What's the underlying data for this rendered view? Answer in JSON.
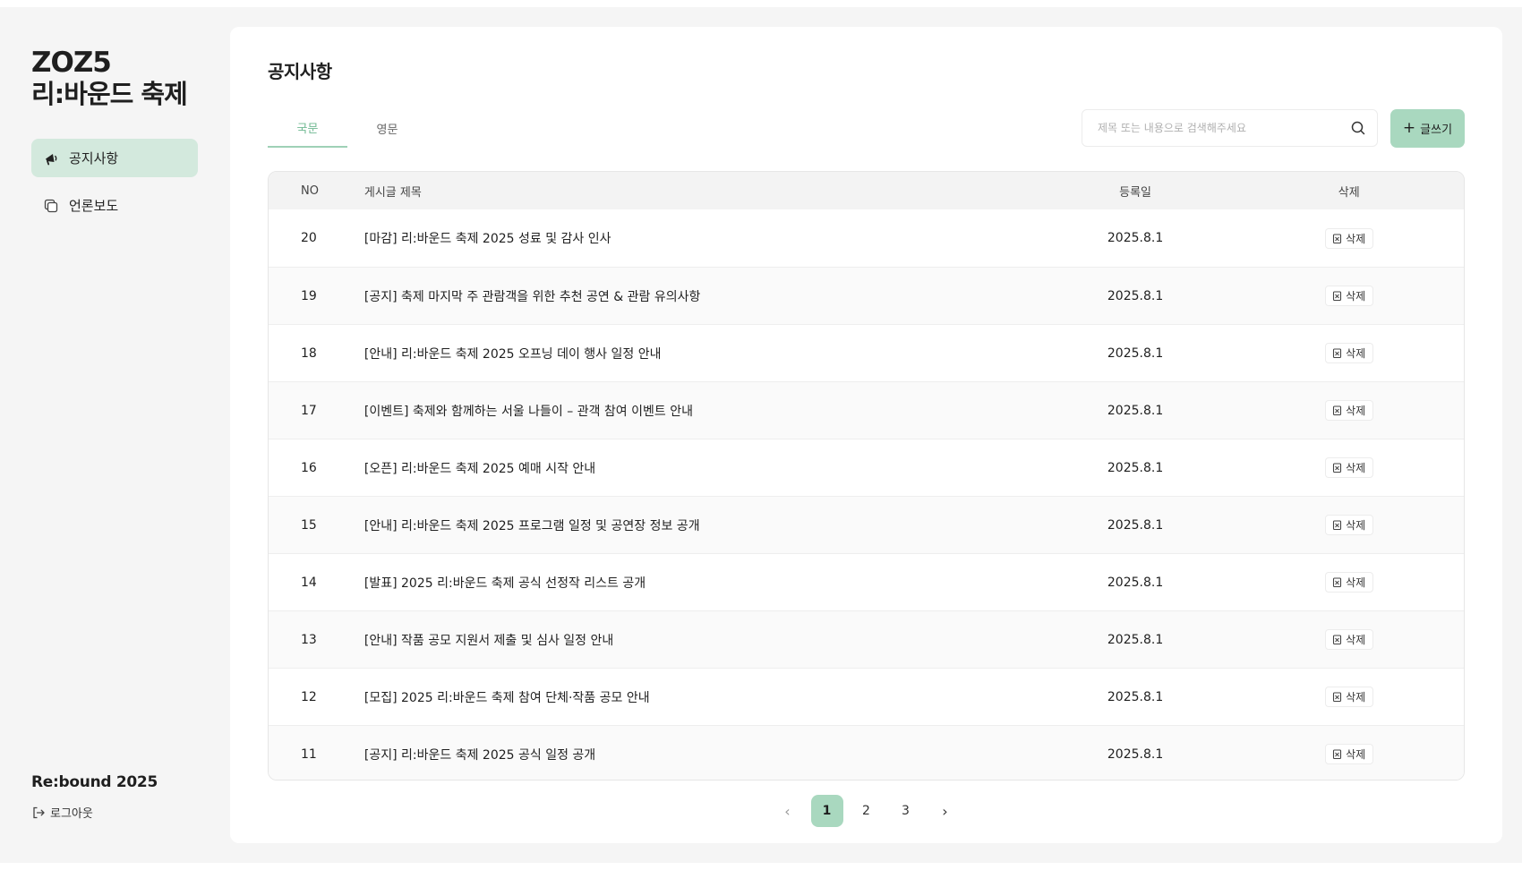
{
  "sidebar": {
    "logo_year": "ZOZ5",
    "logo_title": "리:바운드 축제",
    "items": [
      {
        "label": "공지사항",
        "icon": "megaphone-icon",
        "active": true
      },
      {
        "label": "언론보도",
        "icon": "documents-icon",
        "active": false
      }
    ],
    "brand": "Re:bound 2025",
    "logout_label": "로그아웃"
  },
  "main": {
    "title": "공지사항",
    "tabs": [
      {
        "label": "국문",
        "active": true
      },
      {
        "label": "영문",
        "active": false
      }
    ],
    "search": {
      "placeholder": "제목 또는 내용으로 검색해주세요",
      "value": ""
    },
    "write_label": "글쓰기"
  },
  "table": {
    "headers": {
      "no": "NO",
      "title": "게시글 제목",
      "date": "등록일",
      "delete": "삭제"
    },
    "delete_label": "삭제",
    "rows": [
      {
        "no": "20",
        "title": "[마감] 리:바운드 축제 2025 성료 및 감사 인사",
        "date": "2025.8.1"
      },
      {
        "no": "19",
        "title": "[공지] 축제 마지막 주 관람객을 위한 추천 공연 & 관람 유의사항",
        "date": "2025.8.1"
      },
      {
        "no": "18",
        "title": "[안내] 리:바운드 축제 2025 오프닝 데이 행사 일정 안내",
        "date": "2025.8.1"
      },
      {
        "no": "17",
        "title": "[이벤트] 축제와 함께하는 서울 나들이 – 관객 참여 이벤트 안내",
        "date": "2025.8.1"
      },
      {
        "no": "16",
        "title": "[오픈] 리:바운드 축제 2025 예매 시작 안내",
        "date": "2025.8.1"
      },
      {
        "no": "15",
        "title": "[안내] 리:바운드 축제 2025 프로그램 일정 및 공연장 정보 공개",
        "date": "2025.8.1"
      },
      {
        "no": "14",
        "title": "[발표] 2025 리:바운드 축제 공식 선정작 리스트 공개",
        "date": "2025.8.1"
      },
      {
        "no": "13",
        "title": "[안내] 작품 공모 지원서 제출 및 심사 일정 안내",
        "date": "2025.8.1"
      },
      {
        "no": "12",
        "title": "[모집] 2025 리:바운드 축제 참여 단체·작품 공모 안내",
        "date": "2025.8.1"
      },
      {
        "no": "11",
        "title": "[공지] 리:바운드 축제 2025 공식 일정 공개",
        "date": "2025.8.1"
      }
    ]
  },
  "pagination": {
    "prev": "‹",
    "next": "›",
    "pages": [
      "1",
      "2",
      "3"
    ],
    "current": "1"
  },
  "colors": {
    "accent": "#a9d8bf",
    "accent_light": "#d3e9dd",
    "tab_active_text": "#6fb992",
    "background": "#f5f5f5"
  }
}
